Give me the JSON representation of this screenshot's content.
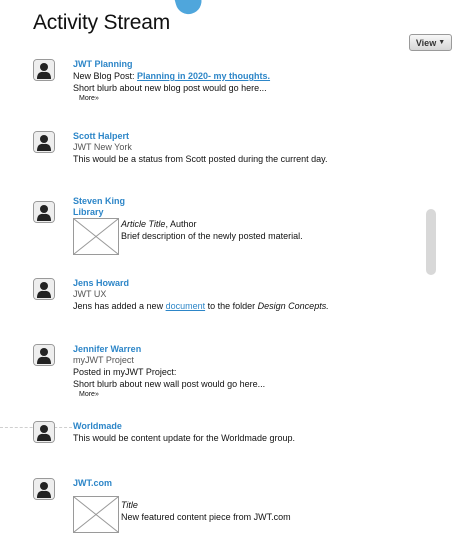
{
  "page": {
    "title": "Activity Stream"
  },
  "toolbar": {
    "view_label": "View"
  },
  "items": [
    {
      "name": "JWT Planning",
      "prefix": "New Blog Post: ",
      "link": "Planning in 2020- my thoughts.",
      "blurb": "Short blurb about new blog post would go here...",
      "more": "More"
    },
    {
      "name": "Scott Halpert",
      "sub": "JWT New York",
      "text": "This would be a status from Scott posted during the current day."
    },
    {
      "name": "Steven King",
      "name2": "Library",
      "title": "Article Title",
      "author": ", Author",
      "desc": "Brief description of the newly posted material."
    },
    {
      "name": "Jens Howard",
      "sub": "JWT UX",
      "text_pre": "Jens has added a new ",
      "link": "document",
      "text_mid": " to the folder ",
      "folder": "Design Concepts."
    },
    {
      "name": "Jennifer Warren",
      "sub": "myJWT Project",
      "line1": "Posted in myJWT Project:",
      "blurb": "Short blurb about new wall post would go here...",
      "more": "More"
    },
    {
      "name": "Worldmade",
      "text": "This would be content update for the Worldmade group."
    },
    {
      "name": "JWT.com",
      "title": "Title",
      "desc": "New featured content piece from JWT.com"
    }
  ]
}
